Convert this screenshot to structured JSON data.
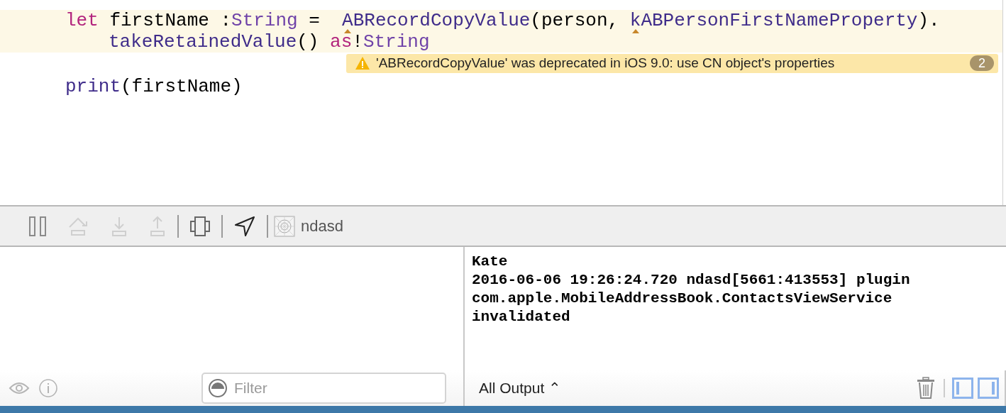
{
  "editor": {
    "lines": [
      {
        "kind": "code",
        "highlighted": true,
        "tokens": [
          {
            "text": "let",
            "kind": "keyword"
          },
          {
            "text": " firstName :",
            "kind": "plain"
          },
          {
            "text": "String",
            "kind": "type"
          },
          {
            "text": " =  ",
            "kind": "plain"
          },
          {
            "text": "A",
            "kind": "call",
            "marked": true
          },
          {
            "text": "BRecordCopyValue",
            "kind": "call"
          },
          {
            "text": "(person, ",
            "kind": "plain"
          },
          {
            "text": "k",
            "kind": "call",
            "marked": true
          },
          {
            "text": "ABPersonFirstNameProperty",
            "kind": "call"
          },
          {
            "text": ").",
            "kind": "plain"
          }
        ]
      },
      {
        "kind": "continuation",
        "highlighted": true,
        "tokens": [
          {
            "text": "takeRetainedValue",
            "kind": "call"
          },
          {
            "text": "() ",
            "kind": "plain"
          },
          {
            "text": "as",
            "kind": "keyword"
          },
          {
            "text": "!",
            "kind": "plain"
          },
          {
            "text": "String",
            "kind": "type"
          }
        ]
      },
      {
        "kind": "warning",
        "message": "'ABRecordCopyValue' was deprecated in iOS 9.0: use CN object's properties",
        "count": "2"
      },
      {
        "kind": "code",
        "highlighted": false,
        "tokens": [
          {
            "text": "print",
            "kind": "call"
          },
          {
            "text": "(firstName)",
            "kind": "plain"
          }
        ]
      }
    ]
  },
  "debug_bar": {
    "items": [
      {
        "kind": "pause",
        "disabled": false
      },
      {
        "kind": "step-over",
        "disabled": true
      },
      {
        "kind": "step-in",
        "disabled": true
      },
      {
        "kind": "step-out",
        "disabled": true
      },
      {
        "kind": "separator"
      },
      {
        "kind": "view-debug",
        "disabled": false
      },
      {
        "kind": "separator"
      },
      {
        "kind": "location",
        "disabled": false
      },
      {
        "kind": "separator"
      },
      {
        "kind": "app",
        "label": "ndasd"
      }
    ]
  },
  "variables_panel": {
    "filter_placeholder": "Filter"
  },
  "console": {
    "lines": [
      "Kate",
      "2016-06-06 19:26:24.720 ndasd[5661:413553] plugin",
      "com.apple.MobileAddressBook.ContactsViewService",
      "invalidated"
    ],
    "output_selector": "All Output ⌃",
    "left_pane_on": true,
    "right_pane_on": true
  }
}
